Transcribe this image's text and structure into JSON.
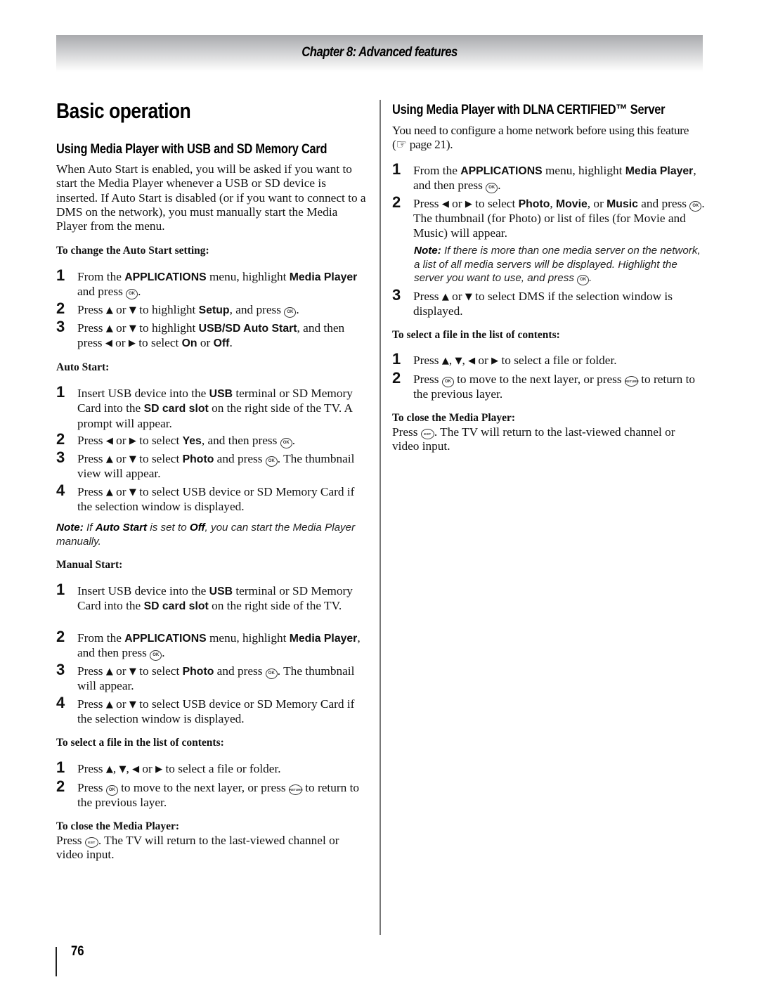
{
  "header": {
    "chapter_title": "Chapter 8: Advanced features"
  },
  "page_title": "Basic operation",
  "left": {
    "section_title": "Using Media Player with USB and SD Memory Card",
    "intro": "When Auto Start is enabled, you will be asked if you want to start the Media Player whenever a USB or SD device is inserted. If Auto Start is disabled (or if you want to connect to a DMS on the network), you must manually start the Media Player from the menu.",
    "change_auto_start": {
      "heading": "To change the Auto Start setting:",
      "steps": [
        {
          "num": "1",
          "t1": "From the ",
          "b1": "APPLICATIONS",
          "t2": " menu, highlight ",
          "b2": "Media Player",
          "t3": " and press ",
          "t4": "."
        },
        {
          "num": "2",
          "t1": "Press ",
          "t2": " or ",
          "t3": " to highlight ",
          "b1": "Setup",
          "t4": ", and press ",
          "t5": "."
        },
        {
          "num": "3",
          "t1": "Press ",
          "t2": " or ",
          "t3": " to highlight ",
          "b1": "USB/SD Auto Start",
          "t4": ", and then press ",
          "t5": " or ",
          "t6": " to select ",
          "b2": "On",
          "t7": " or ",
          "b3": "Off",
          "t8": "."
        }
      ]
    },
    "auto_start": {
      "heading": "Auto Start:",
      "steps": [
        {
          "num": "1",
          "t1": "Insert USB device into the ",
          "b1": "USB",
          "t2": " terminal or SD Memory Card into the ",
          "b2": "SD card slot",
          "t3": " on the right side of the TV. A prompt will appear."
        },
        {
          "num": "2",
          "t1": "Press ",
          "t2": " or ",
          "t3": " to select ",
          "b1": "Yes",
          "t4": ", and then press ",
          "t5": "."
        },
        {
          "num": "3",
          "t1": "Press ",
          "t2": " or ",
          "t3": " to select ",
          "b1": "Photo",
          "t4": " and press ",
          "t5": ". The thumbnail view will appear."
        },
        {
          "num": "4",
          "t1": "Press ",
          "t2": " or ",
          "t3": " to select USB device or SD Memory Card if the selection window is displayed."
        }
      ],
      "note": {
        "label": "Note:",
        "t1": " If ",
        "b1": "Auto Start",
        "t2": " is set to ",
        "b2": "Off",
        "t3": ", you can start the Media Player manually."
      }
    },
    "manual_start": {
      "heading": "Manual Start:",
      "steps": [
        {
          "num": "1",
          "t1": "Insert USB device into the ",
          "b1": "USB",
          "t2": " terminal or SD Memory Card into the ",
          "b2": "SD card slot",
          "t3": " on the right side of the TV."
        },
        {
          "num": "2",
          "t1": "From the ",
          "b1": "APPLICATIONS",
          "t2": " menu, highlight ",
          "b2": "Media Player",
          "t3": ", and then press ",
          "t4": "."
        },
        {
          "num": "3",
          "t1": "Press ",
          "t2": " or ",
          "t3": " to select ",
          "b1": "Photo",
          "t4": " and press ",
          "t5": ". The thumbnail will appear."
        },
        {
          "num": "4",
          "t1": "Press ",
          "t2": " or ",
          "t3": " to select USB device or SD Memory Card if the selection window is displayed."
        }
      ]
    },
    "select_file": {
      "heading": "To select a file in the list of contents:",
      "steps": [
        {
          "num": "1",
          "t1": "Press ",
          "c1": ", ",
          "c2": ", ",
          "t2": " or ",
          "t3": " to select a file or folder."
        },
        {
          "num": "2",
          "t1": "Press ",
          "t2": " to move to the next layer, or press ",
          "t3": " to return to the previous layer."
        }
      ]
    },
    "close_player": {
      "heading": "To close the Media Player:",
      "t1": "Press ",
      "t2": ". The TV will return to the last-viewed channel or video input."
    }
  },
  "right": {
    "section_title": "Using Media Player with DLNA CERTIFIED™ Server",
    "intro_t1": "You need to configure a home network before using this feature (",
    "intro_ref_icon": "☞",
    "intro_t2": " page 21).",
    "steps": [
      {
        "num": "1",
        "t1": "From the ",
        "b1": "APPLICATIONS",
        "t2": " menu, highlight ",
        "b2": "Media Player",
        "t3": ", and then press ",
        "t4": "."
      },
      {
        "num": "2",
        "t1": "Press ",
        "t2": " or ",
        "t3": " to select ",
        "b1": "Photo",
        "c1": ", ",
        "b2": "Movie",
        "c2": ", or ",
        "b3": "Music",
        "t4": " and press ",
        "t5": ". The thumbnail (for Photo) or list of files (for Movie and Music) will appear."
      },
      {
        "num": "3",
        "t1": "Press ",
        "t2": " or ",
        "t3": " to select DMS if the selection window is displayed."
      }
    ],
    "note": {
      "label": "Note:",
      "t1": " If there is more than one media server on the network, a list of all media servers will be displayed. Highlight the server you want to use, and press ",
      "t2": "."
    },
    "select_file": {
      "heading": "To select a file in the list of contents:",
      "steps": [
        {
          "num": "1",
          "t1": "Press ",
          "c1": ", ",
          "c2": ", ",
          "t2": " or ",
          "t3": " to select a file or folder."
        },
        {
          "num": "2",
          "t1": "Press ",
          "t2": " to move to the next layer, or press ",
          "t3": " to return to the previous layer."
        }
      ]
    },
    "close_player": {
      "heading": "To close the Media Player:",
      "t1": "Press ",
      "t2": ". The TV will return to the last-viewed channel or video input."
    }
  },
  "icons": {
    "ok": "OK",
    "return": "RETURN",
    "exit": "EXIT",
    "up": "▲",
    "down": "▼",
    "left": "◀",
    "right": "▶"
  },
  "footer": {
    "page_number": "76"
  }
}
